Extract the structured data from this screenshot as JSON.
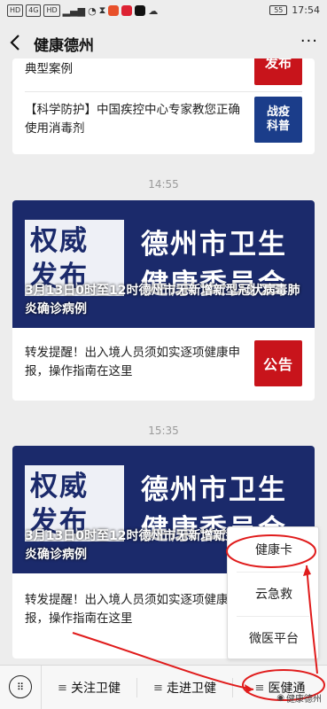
{
  "status_bar": {
    "badges": [
      "HD",
      "4G",
      "HD"
    ],
    "battery": "55",
    "time": "17:54"
  },
  "nav": {
    "title": "健康德州",
    "more": "···"
  },
  "feed": {
    "card1": {
      "item1_text": "典型案例",
      "item1_thumb": "发布",
      "item2_text": "【科学防护】中国疾控中心专家教您正确使用消毒剂",
      "item2_thumb_line1": "战疫",
      "item2_thumb_line2": "科普"
    },
    "time1": "14:55",
    "card2": {
      "stamp": "权威发布",
      "org": "德州市卫生健康委员会",
      "caption": "3月13日0时至12时德州市无新增新型冠状病毒肺炎确诊病例",
      "item_text": "转发提醒！出入境人员须如实逐项健康申报，操作指南在这里",
      "item_thumb": "公告"
    },
    "time2": "15:35",
    "card3": {
      "stamp": "权威发布",
      "org": "德州市卫生健康委员会",
      "caption": "3月13日0时至12时德州市无新增新型冠状病毒肺炎确诊病例",
      "item_text": "转发提醒！出入境人员须如实逐项健康申报，操作指南在这里"
    }
  },
  "popup_menu": {
    "items": [
      "健康卡",
      "云急救",
      "微医平台"
    ]
  },
  "bottom_menu": {
    "items": [
      "关注卫健",
      "走进卫健",
      "医健通"
    ]
  },
  "watermark": "健康德州",
  "colors": {
    "banner_blue": "#1b2a6b",
    "notice_red": "#c8141b",
    "annotation_red": "#e01c1c"
  }
}
